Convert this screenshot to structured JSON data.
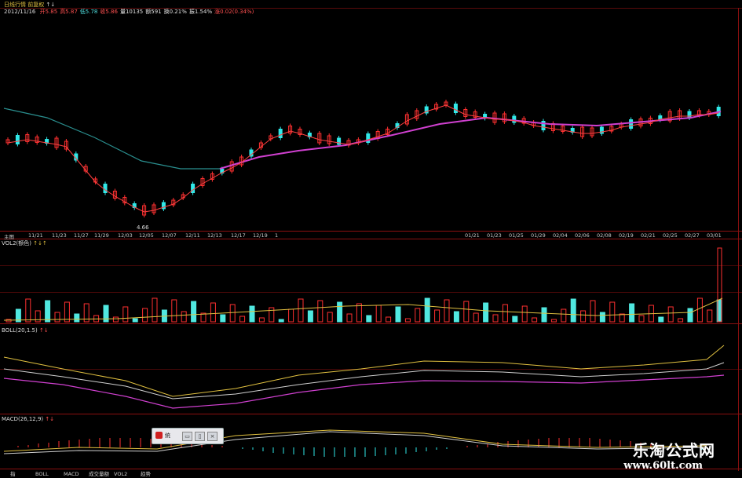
{
  "colors": {
    "up": "#ff3030",
    "down": "#30e8e8",
    "ma_slow": "#d040d0",
    "ma_mid": "#2a8f8f",
    "grid": "#8a1010",
    "text": "#cfcfcf",
    "yellow": "#e0c040"
  },
  "header": {
    "title": "日线行情",
    "title2": "前复权",
    "arrows": "↑↓",
    "date": "2012/11/16",
    "fields": [
      {
        "label": "开",
        "value": "5.85",
        "color": "#ff5050"
      },
      {
        "label": "高",
        "value": "5.87",
        "color": "#ff5050"
      },
      {
        "label": "低",
        "value": "5.78",
        "color": "#50e0e0"
      },
      {
        "label": "收",
        "value": "5.86",
        "color": "#ff5050"
      },
      {
        "label": "量",
        "value": "10135",
        "color": "#e0e0e0"
      },
      {
        "label": "额",
        "value": "591",
        "color": "#e0e0e0"
      },
      {
        "label": "换",
        "value": "0.21%",
        "color": "#e0e0e0"
      },
      {
        "label": "振",
        "value": "1.54%",
        "color": "#e0e0e0"
      },
      {
        "label": "涨",
        "value": "0.02(0.34%)",
        "color": "#ff5050"
      }
    ]
  },
  "price_low_label": "4.66",
  "xaxis_labels": [
    "主图",
    "11/21",
    "11/23",
    "11/27",
    "11/29",
    "12/03",
    "12/05",
    "12/07",
    "12/11",
    "12/13",
    "12/17",
    "12/19",
    "1",
    "01/21",
    "01/23",
    "01/25",
    "01/29",
    "02/04",
    "02/06",
    "02/08",
    "02/19",
    "02/21",
    "02/25",
    "02/27",
    "03/01"
  ],
  "panels": {
    "volume": "VOL2(额色)",
    "volume_arrows": "↑↓↑",
    "boll": "BOLL(20,1.5)",
    "boll_arrows": "↑↓",
    "macd": "MACD(26,12,9)",
    "macd_arrows": "↑↓"
  },
  "popup": {
    "label": "统",
    "btn1": "▭",
    "btn2": "▯",
    "btn3": "×"
  },
  "bottom_tabs": [
    "指",
    "BOLL",
    "MACD",
    "成交量额",
    "VOL2",
    "趋势"
  ],
  "watermark": {
    "line1": "乐淘公式网",
    "line2": "www.60lt.com"
  }
}
